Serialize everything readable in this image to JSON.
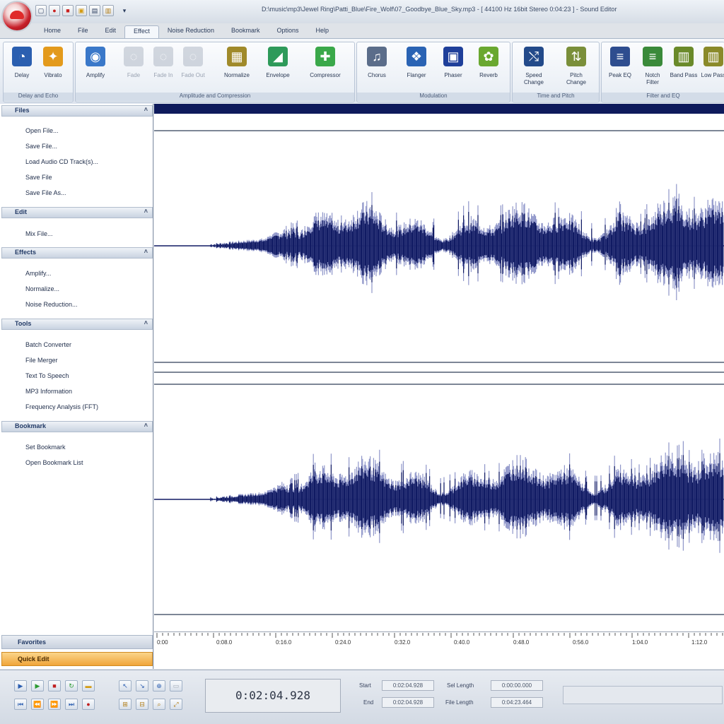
{
  "title": "D:\\music\\mp3\\Jewel Ring\\Patti_Blue\\Fire_Wolf\\07_Goodbye_Blue_Sky.mp3 - [ 44100 Hz 16bit Stereo 0:04:23 ] - Sound Editor",
  "quick_access": [
    "▢",
    "●",
    "■",
    "▣",
    "▤",
    "▥",
    "▾"
  ],
  "tabs": [
    "Home",
    "File",
    "Edit",
    "Effect",
    "Noise Reduction",
    "Bookmark",
    "Options",
    "Help"
  ],
  "active_tab": "Effect",
  "ribbon": {
    "groups": [
      {
        "caption": "Delay and Echo",
        "buttons": [
          {
            "label": "Delay",
            "icon": "delay-icon"
          },
          {
            "label": "Vibrato",
            "icon": "vibrato-icon"
          }
        ]
      },
      {
        "caption": "Amplitude and Compression",
        "buttons": [
          {
            "label": "Amplify",
            "icon": "amplify-icon"
          },
          {
            "label": "Fade",
            "icon": "fade-icon"
          },
          {
            "label": "Fade In",
            "icon": "fade-in-icon"
          },
          {
            "label": "Fade Out",
            "icon": "fade-out-icon"
          },
          {
            "label": "Normalize",
            "icon": "normalize-icon"
          },
          {
            "label": "Envelope",
            "icon": "envelope-icon"
          },
          {
            "label": "Compressor",
            "icon": "compressor-icon"
          }
        ]
      },
      {
        "caption": "Modulation",
        "buttons": [
          {
            "label": "Chorus",
            "icon": "chorus-icon"
          },
          {
            "label": "Flanger",
            "icon": "flanger-icon"
          },
          {
            "label": "Phaser",
            "icon": "phaser-icon"
          },
          {
            "label": "Reverb",
            "icon": "reverb-icon"
          }
        ]
      },
      {
        "caption": "Time and Pitch",
        "buttons": [
          {
            "label": "Speed Change",
            "icon": "speed-change-icon"
          },
          {
            "label": "Pitch Change",
            "icon": "pitch-change-icon"
          }
        ]
      },
      {
        "caption": "Filter and EQ",
        "buttons": [
          {
            "label": "Peak EQ",
            "icon": "peak-eq-icon"
          },
          {
            "label": "Notch Filter",
            "icon": "notch-filter-icon"
          },
          {
            "label": "Band Pass",
            "icon": "band-pass-icon"
          },
          {
            "label": "Low Pass",
            "icon": "low-pass-icon"
          }
        ]
      }
    ]
  },
  "sidebar": {
    "sections": [
      {
        "title": "Files",
        "items": [
          "Open File...",
          "Save File...",
          "Load Audio CD Track(s)...",
          "Save File",
          "Save File As..."
        ]
      },
      {
        "title": "Edit",
        "items": [
          "Mix File..."
        ]
      },
      {
        "title": "Effects",
        "items": [
          "Amplify...",
          "Normalize...",
          "Noise Reduction..."
        ]
      },
      {
        "title": "Tools",
        "items": [
          "Batch Converter",
          "File Merger",
          "Text To Speech",
          "MP3 Information",
          "Frequency Analysis (FFT)"
        ]
      },
      {
        "title": "Bookmark",
        "items": [
          "Set Bookmark",
          "Open Bookmark List"
        ]
      }
    ],
    "bottom_tabs": [
      "Favorites",
      "Quick Edit"
    ]
  },
  "timeline": {
    "ticks": [
      "0:00",
      "0:08.0",
      "0:16.0",
      "0:24.0",
      "0:32.0",
      "0:40.0",
      "0:48.0",
      "0:56.0",
      "1:04.0",
      "1:12.0"
    ]
  },
  "status": {
    "time": "0:02:04.928",
    "start_label": "Start",
    "start_value": "0:02:04.928",
    "end_label": "End",
    "end_value": "0:02:04.928",
    "sel_length_label": "Sel Length",
    "sel_length_value": "0:00:00.000",
    "file_length_label": "File Length",
    "file_length_value": "0:04:23.464"
  },
  "colors": {
    "waveform": "#101a63",
    "waveform_edge": "#8f96c9",
    "overview": "#0e1a5c",
    "accent": "#f5b54a"
  }
}
